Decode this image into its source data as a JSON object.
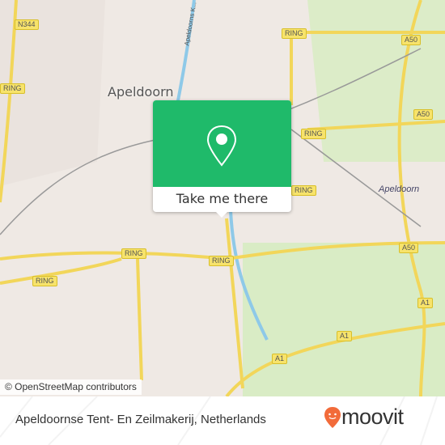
{
  "map": {
    "city_label": "Apeldoorn",
    "area_label": "Apeldoorn",
    "canal_label": "Apeldoorns K...",
    "road_shields": {
      "n344": "N344",
      "ring": "RING",
      "a50": "A50",
      "a1": "A1"
    },
    "attribution": "© OpenStreetMap contributors",
    "colors": {
      "land": "#efe9e4",
      "park": "#cfe6b4",
      "water": "#8ec9e8",
      "road": "#f7e36b",
      "accent": "#1fba6a"
    }
  },
  "popup": {
    "button_label": "Take me there",
    "icon": "map-pin-icon"
  },
  "footer": {
    "place_name": "Apeldoornse Tent- En Zeilmakerij, Netherlands",
    "brand": "moovit",
    "brand_color": "#f26b3a"
  }
}
